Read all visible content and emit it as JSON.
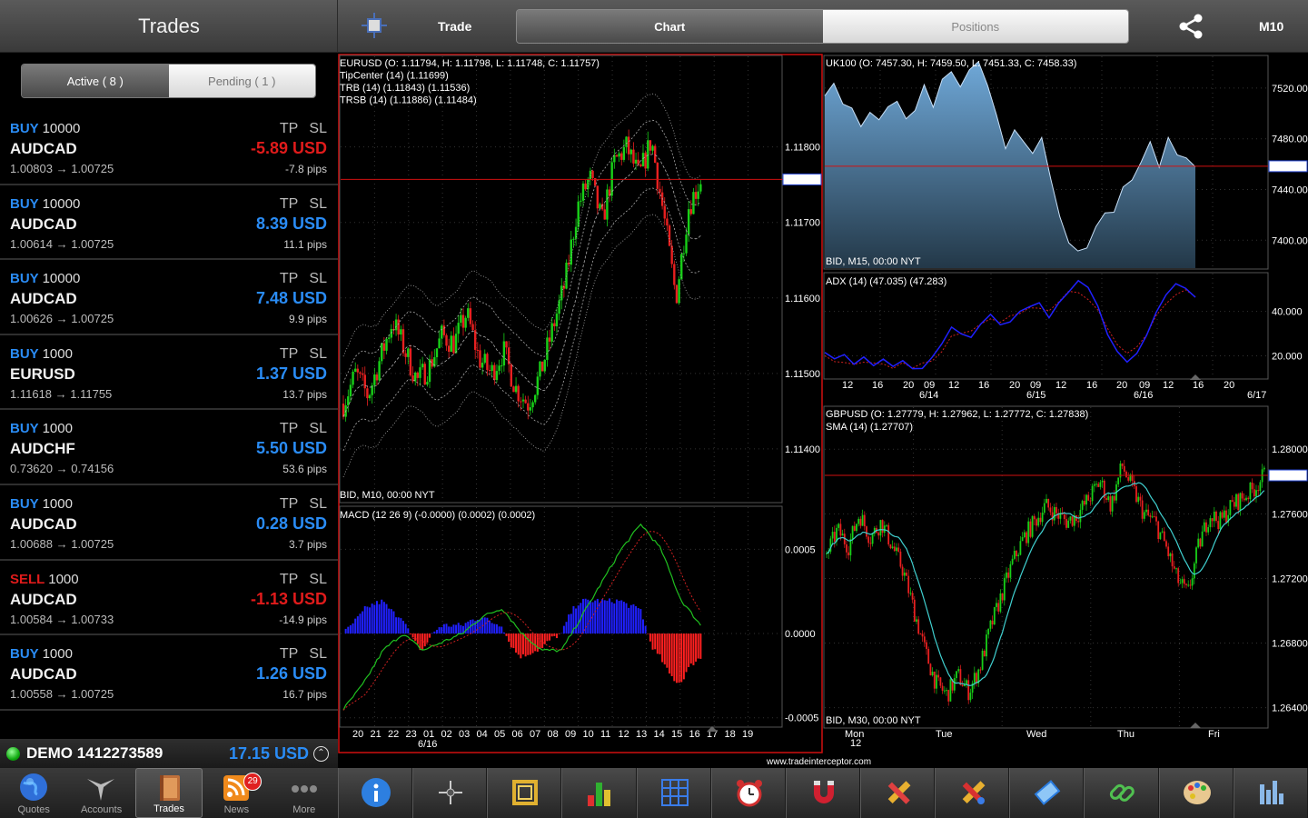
{
  "left_header": {
    "title": "Trades"
  },
  "trade_tabs": {
    "active": "Active ( 8 )",
    "pending": "Pending ( 1 )"
  },
  "trades": [
    {
      "side": "BUY",
      "qty": "10000",
      "symbol": "AUDCAD",
      "prices": "1.00803 → 1.00725",
      "tp": "TP",
      "sl": "SL",
      "pl": "-5.89 USD",
      "pips": "-7.8 pips",
      "positive": false
    },
    {
      "side": "BUY",
      "qty": "10000",
      "symbol": "AUDCAD",
      "prices": "1.00614 → 1.00725",
      "tp": "TP",
      "sl": "SL",
      "pl": "8.39 USD",
      "pips": "11.1 pips",
      "positive": true
    },
    {
      "side": "BUY",
      "qty": "10000",
      "symbol": "AUDCAD",
      "prices": "1.00626 → 1.00725",
      "tp": "TP",
      "sl": "SL",
      "pl": "7.48 USD",
      "pips": "9.9 pips",
      "positive": true
    },
    {
      "side": "BUY",
      "qty": "1000",
      "symbol": "EURUSD",
      "prices": "1.11618 → 1.11755",
      "tp": "TP",
      "sl": "SL",
      "pl": "1.37 USD",
      "pips": "13.7 pips",
      "positive": true
    },
    {
      "side": "BUY",
      "qty": "1000",
      "symbol": "AUDCHF",
      "prices": "0.73620 → 0.74156",
      "tp": "TP",
      "sl": "SL",
      "pl": "5.50 USD",
      "pips": "53.6 pips",
      "positive": true
    },
    {
      "side": "BUY",
      "qty": "1000",
      "symbol": "AUDCAD",
      "prices": "1.00688 → 1.00725",
      "tp": "TP",
      "sl": "SL",
      "pl": "0.28 USD",
      "pips": "3.7 pips",
      "positive": true
    },
    {
      "side": "SELL",
      "qty": "1000",
      "symbol": "AUDCAD",
      "prices": "1.00584 → 1.00733",
      "tp": "TP",
      "sl": "SL",
      "pl": "-1.13 USD",
      "pips": "-14.9 pips",
      "positive": false
    },
    {
      "side": "BUY",
      "qty": "1000",
      "symbol": "AUDCAD",
      "prices": "1.00558 → 1.00725",
      "tp": "TP",
      "sl": "SL",
      "pl": "1.26 USD",
      "pips": "16.7 pips",
      "positive": true
    }
  ],
  "account": {
    "name": "DEMO 1412273589",
    "balance": "17.15 USD"
  },
  "tabbar": [
    {
      "label": "Quotes",
      "icon": "globe-icon"
    },
    {
      "label": "Accounts",
      "icon": "accounts-icon"
    },
    {
      "label": "Trades",
      "icon": "trades-book-icon",
      "selected": true
    },
    {
      "label": "News",
      "icon": "rss-news-icon",
      "badge": "29"
    },
    {
      "label": "More",
      "icon": "more-dots-icon"
    }
  ],
  "right_header": {
    "trade": "Trade",
    "chart_tab": "Chart",
    "positions_tab": "Positions",
    "timeframe": "M10"
  },
  "watermark": "www.tradeinterceptor.com",
  "colors": {
    "buy": "#2a8cf5",
    "sell": "#e01b1b",
    "up_candle": "#18d018",
    "down_candle": "#e82020",
    "area_fill": "#6fa0c8",
    "adx": "#2020ff",
    "sma": "#40d0d0"
  },
  "charts": {
    "eurusd": {
      "info": [
        "EURUSD (O: 1.11794, H: 1.11798, L: 1.11748, C: 1.11757)",
        "TipCenter (14) (1.11699)",
        "TRB (14) (1.11843) (1.11536)",
        "TRSB (14) (1.11886) (1.11484)"
      ],
      "footer": "BID, M10, 00:00 NYT",
      "y_ticks": [
        "1.11800",
        "1.11700",
        "1.11600",
        "1.11500",
        "1.11400"
      ],
      "current": "1.11757"
    },
    "macd": {
      "info": "MACD (12 26 9) (-0.0000) (0.0002) (0.0002)",
      "y_ticks": [
        "0.0005",
        "0.0000",
        "-0.0005"
      ]
    },
    "x_axis": {
      "ticks": [
        "20",
        "21",
        "22",
        "23",
        "01",
        "02",
        "03",
        "04",
        "05",
        "06",
        "07",
        "08",
        "09",
        "10",
        "11",
        "12",
        "13",
        "14",
        "15",
        "16",
        "17",
        "18",
        "19"
      ],
      "date": "6/16"
    },
    "uk100": {
      "info": "UK100 (O: 7457.30, H: 7459.50, L: 7451.33, C: 7458.33)",
      "footer": "BID, M15, 00:00 NYT",
      "y_ticks": [
        "7520.00",
        "7480.00",
        "7440.00",
        "7400.00"
      ],
      "current": "7458.33"
    },
    "adx": {
      "info": "ADX (14) (47.035) (47.283)",
      "y_ticks": [
        "40.000",
        "20.000"
      ]
    },
    "adx_x_axis": {
      "ticks": [
        "12",
        "16",
        "20",
        "09",
        "12",
        "16",
        "20",
        "09",
        "12",
        "16",
        "20",
        "09",
        "12",
        "16",
        "20"
      ],
      "dates": [
        "6/14",
        "6/15",
        "6/16",
        "6/17"
      ]
    },
    "gbpusd": {
      "info": [
        "GBPUSD (O: 1.27779, H: 1.27962, L: 1.27772, C: 1.27838)",
        "SMA (14) (1.27707)"
      ],
      "footer": "BID, M30, 00:00 NYT",
      "y_ticks": [
        "1.28000",
        "1.27600",
        "1.27200",
        "1.26800",
        "1.26400"
      ],
      "current": "1.27838"
    },
    "gbpusd_x_axis": {
      "ticks": [
        "Mon",
        "Tue",
        "Wed",
        "Thu",
        "Fri"
      ],
      "sub": "12"
    }
  },
  "toolbar": [
    "info-icon",
    "crosshair-icon",
    "frame-icon",
    "bar-chart-icon",
    "grid-icon",
    "alarm-clock-icon",
    "magnet-icon",
    "pencil-ruler-icon",
    "pencil-ruler-alt-icon",
    "eraser-icon",
    "link-icon",
    "palette-icon",
    "chart-settings-icon"
  ]
}
